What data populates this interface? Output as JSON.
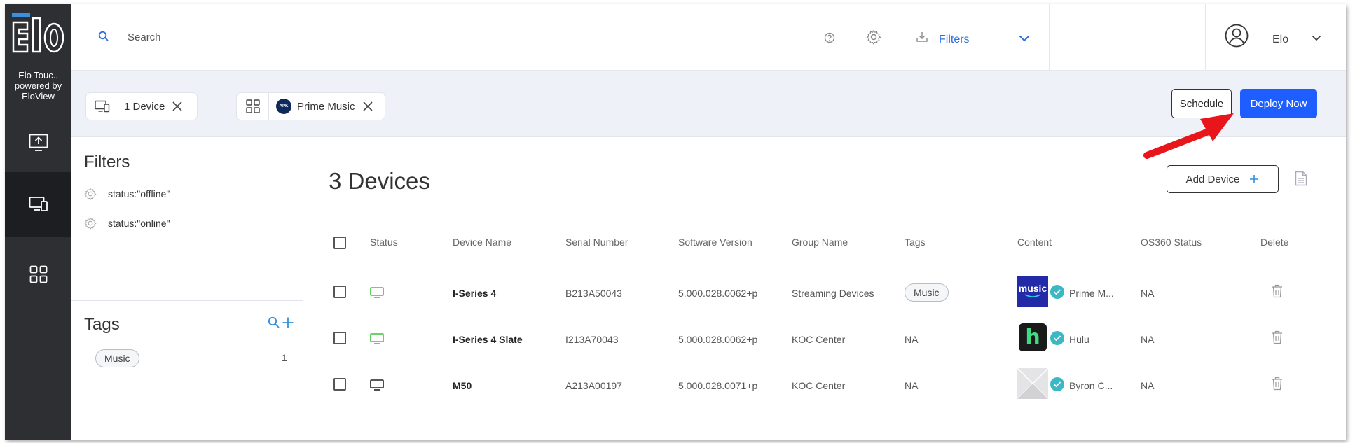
{
  "sidebar": {
    "brand_line1": "Elo Touc..",
    "brand_line2": "powered by",
    "brand_line3": "EloView",
    "items": [
      {
        "name": "upload"
      },
      {
        "name": "devices",
        "active": true
      },
      {
        "name": "apps"
      }
    ]
  },
  "header": {
    "search_placeholder": "Search",
    "filters_label": "Filters",
    "user_name": "Elo"
  },
  "selection": {
    "device_chip": "1 Device",
    "app_chip": "Prime Music",
    "apk_badge": "APK",
    "schedule_label": "Schedule",
    "deploy_label": "Deploy Now"
  },
  "filters": {
    "title": "Filters",
    "items": [
      {
        "label": "status:\"offline\""
      },
      {
        "label": "status:\"online\""
      }
    ]
  },
  "tags": {
    "title": "Tags",
    "items": [
      {
        "label": "Music",
        "count": "1"
      }
    ]
  },
  "devices": {
    "title": "3 Devices",
    "add_label": "Add Device",
    "columns": [
      "Status",
      "Device Name",
      "Serial Number",
      "Software Version",
      "Group Name",
      "Tags",
      "Content",
      "OS360 Status",
      "Delete"
    ],
    "rows": [
      {
        "status": "online",
        "name": "I-Series 4",
        "serial": "B213A50043",
        "version": "5.000.028.0062+p",
        "group": "Streaming Devices",
        "tag": "Music",
        "content": "Prime M...",
        "content_thumb_text": "music",
        "os360": "NA"
      },
      {
        "status": "online",
        "name": "I-Series 4 Slate",
        "serial": "I213A70043",
        "version": "5.000.028.0062+p",
        "group": "KOC Center",
        "tag": "NA",
        "content": "Hulu",
        "content_thumb_text": "h",
        "os360": "NA"
      },
      {
        "status": "offline",
        "name": "M50",
        "serial": "A213A00197",
        "version": "5.000.028.0071+p",
        "group": "KOC Center",
        "tag": "NA",
        "content": "Byron C...",
        "content_thumb_text": "",
        "os360": "NA"
      }
    ]
  },
  "colors": {
    "accent": "#1e5eff",
    "link": "#2f6fe0",
    "online": "#3cc43c",
    "offline": "#222222",
    "annotation": "#e8161b"
  }
}
